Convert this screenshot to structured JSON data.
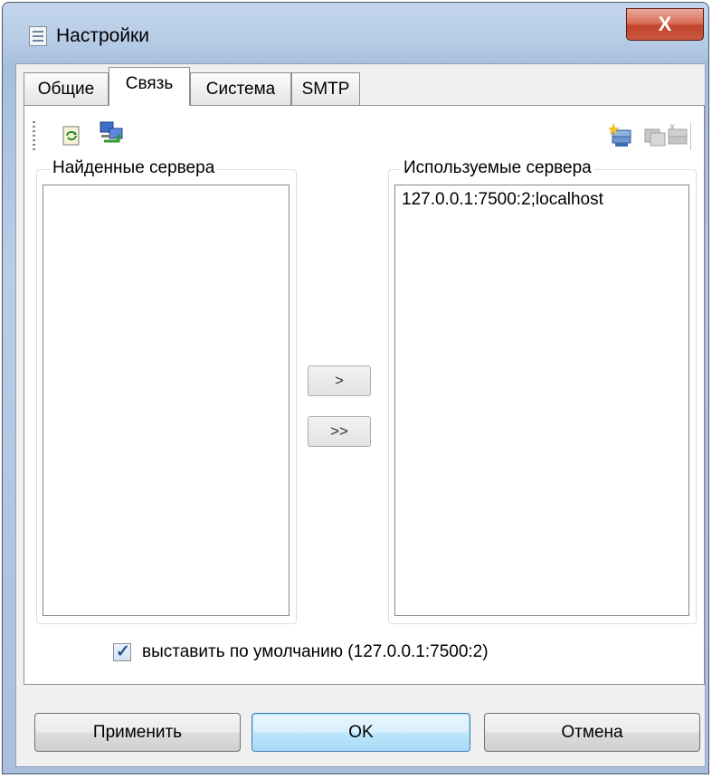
{
  "window": {
    "title": "Настройки",
    "close_glyph": "X",
    "icon": "settings-list-icon"
  },
  "tabs": [
    {
      "label": "Общие",
      "active": false
    },
    {
      "label": "Связь",
      "active": true
    },
    {
      "label": "Система",
      "active": false
    },
    {
      "label": "SMTP",
      "active": false
    }
  ],
  "toolbar": {
    "left_icons": [
      "refresh-icon",
      "network-computers-icon"
    ],
    "right_icons": [
      "add-server-icon",
      "copy-server-icon",
      "delete-server-icon"
    ]
  },
  "found_servers": {
    "label": "Найденные сервера",
    "items": []
  },
  "used_servers": {
    "label": "Используемые сервера",
    "items": [
      "127.0.0.1:7500:2;localhost"
    ]
  },
  "move_buttons": {
    "move_one": ">",
    "move_all": ">>"
  },
  "default_checkbox": {
    "checked": true,
    "label": "выставить по умолчанию (127.0.0.1:7500:2)"
  },
  "buttons": {
    "apply": "Применить",
    "ok": "OK",
    "cancel": "Отмена"
  },
  "colors": {
    "frame": "#b9cde6",
    "close_button": "#c94a32",
    "default_button_border": "#3c7fb1"
  }
}
